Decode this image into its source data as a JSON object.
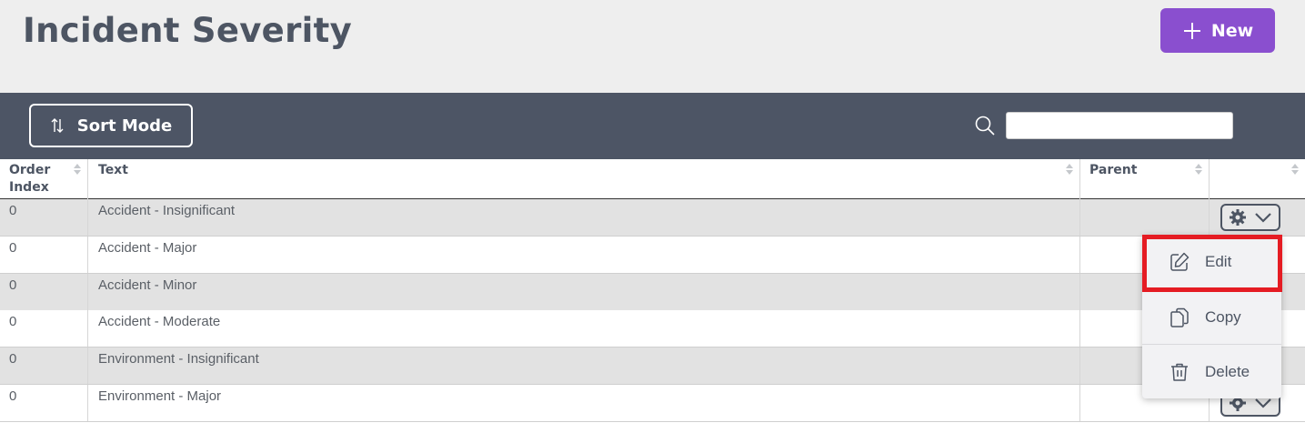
{
  "header": {
    "title": "Incident Severity",
    "new_label": "New"
  },
  "toolbar": {
    "sort_label": "Sort Mode",
    "search_value": "",
    "search_placeholder": ""
  },
  "grid": {
    "columns": [
      "Order Index",
      "Text",
      "Parent",
      ""
    ],
    "column_order_line1": "Order",
    "column_order_line2": "Index",
    "rows": [
      {
        "order": "0",
        "text": "Accident - Insignificant",
        "parent": ""
      },
      {
        "order": "0",
        "text": "Accident - Major",
        "parent": ""
      },
      {
        "order": "0",
        "text": "Accident - Minor",
        "parent": ""
      },
      {
        "order": "0",
        "text": "Accident - Moderate",
        "parent": ""
      },
      {
        "order": "0",
        "text": "Environment - Insignificant",
        "parent": ""
      },
      {
        "order": "0",
        "text": "Environment - Major",
        "parent": ""
      }
    ]
  },
  "action_menu": {
    "items": [
      {
        "label": "Edit",
        "icon": "edit-icon"
      },
      {
        "label": "Copy",
        "icon": "copy-icon"
      },
      {
        "label": "Delete",
        "icon": "trash-icon"
      }
    ],
    "highlighted": "Edit"
  },
  "colors": {
    "accent": "#8a4fcf",
    "toolbar": "#4d5565",
    "highlight": "#e51c23"
  }
}
